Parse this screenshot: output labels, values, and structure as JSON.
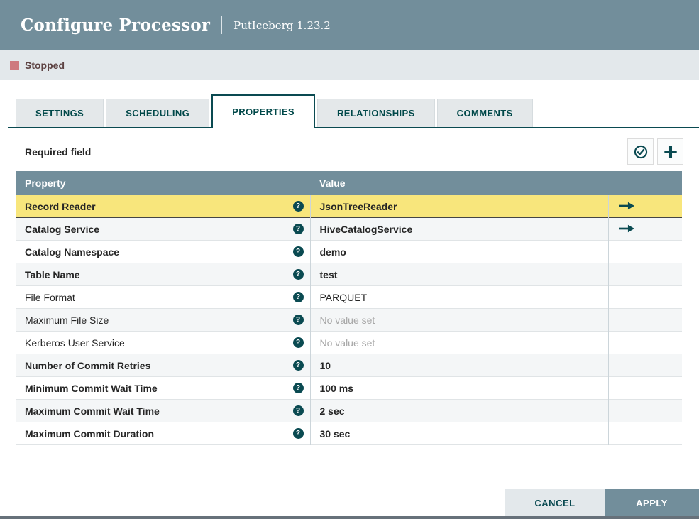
{
  "dialog": {
    "title": "Configure Processor",
    "subtitle": "PutIceberg 1.23.2",
    "status": {
      "label": "Stopped"
    },
    "tabs": [
      {
        "label": "SETTINGS",
        "active": false
      },
      {
        "label": "SCHEDULING",
        "active": false
      },
      {
        "label": "PROPERTIES",
        "active": true
      },
      {
        "label": "RELATIONSHIPS",
        "active": false
      },
      {
        "label": "COMMENTS",
        "active": false
      }
    ],
    "properties_panel": {
      "required_field_label": "Required field",
      "actions": [
        {
          "name": "verify-properties",
          "icon": "check-circle-icon"
        },
        {
          "name": "add-property",
          "icon": "plus-icon"
        }
      ],
      "table": {
        "columns": [
          "Property",
          "Value"
        ],
        "rows": [
          {
            "property": "Record Reader",
            "value": "JsonTreeReader",
            "bold": true,
            "empty": false,
            "highlighted": true,
            "has_goto": true
          },
          {
            "property": "Catalog Service",
            "value": "HiveCatalogService",
            "bold": true,
            "empty": false,
            "highlighted": false,
            "has_goto": true
          },
          {
            "property": "Catalog Namespace",
            "value": "demo",
            "bold": true,
            "empty": false,
            "highlighted": false,
            "has_goto": false
          },
          {
            "property": "Table Name",
            "value": "test",
            "bold": true,
            "empty": false,
            "highlighted": false,
            "has_goto": false
          },
          {
            "property": "File Format",
            "value": "PARQUET",
            "bold": false,
            "empty": false,
            "highlighted": false,
            "has_goto": false
          },
          {
            "property": "Maximum File Size",
            "value": "No value set",
            "bold": false,
            "empty": true,
            "highlighted": false,
            "has_goto": false
          },
          {
            "property": "Kerberos User Service",
            "value": "No value set",
            "bold": false,
            "empty": true,
            "highlighted": false,
            "has_goto": false
          },
          {
            "property": "Number of Commit Retries",
            "value": "10",
            "bold": true,
            "empty": false,
            "highlighted": false,
            "has_goto": false
          },
          {
            "property": "Minimum Commit Wait Time",
            "value": "100 ms",
            "bold": true,
            "empty": false,
            "highlighted": false,
            "has_goto": false
          },
          {
            "property": "Maximum Commit Wait Time",
            "value": "2 sec",
            "bold": true,
            "empty": false,
            "highlighted": false,
            "has_goto": false
          },
          {
            "property": "Maximum Commit Duration",
            "value": "30 sec",
            "bold": true,
            "empty": false,
            "highlighted": false,
            "has_goto": false
          }
        ]
      }
    },
    "footer": {
      "cancel_label": "CANCEL",
      "apply_label": "APPLY"
    },
    "icons": {
      "help_glyph": "?"
    },
    "colors": {
      "header_bg": "#728e9b",
      "status_bar_bg": "#e3e8eb",
      "stopped_red": "#ce797e",
      "stopped_text": "#5d4242",
      "accent_teal": "#0a4a51",
      "table_header_bg": "#728e9b",
      "highlight_yellow": "#f8e67c",
      "alt_row_bg": "#f4f6f7",
      "empty_value_gray": "#a7a7a7"
    }
  }
}
